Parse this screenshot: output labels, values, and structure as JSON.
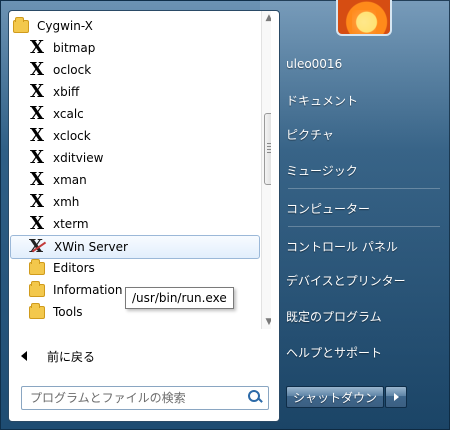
{
  "programs": {
    "folder_title": "Cygwin-X",
    "apps": [
      {
        "label": "bitmap",
        "icon": "x-icon"
      },
      {
        "label": "oclock",
        "icon": "x-icon"
      },
      {
        "label": "xbiff",
        "icon": "x-icon"
      },
      {
        "label": "xcalc",
        "icon": "x-icon"
      },
      {
        "label": "xclock",
        "icon": "x-icon"
      },
      {
        "label": "xditview",
        "icon": "x-icon"
      },
      {
        "label": "xman",
        "icon": "x-icon"
      },
      {
        "label": "xmh",
        "icon": "x-icon"
      },
      {
        "label": "xterm",
        "icon": "x-icon"
      },
      {
        "label": "XWin Server",
        "icon": "xwin-icon"
      }
    ],
    "folders": [
      "Editors",
      "Information",
      "Tools"
    ]
  },
  "tooltip": "/usr/bin/run.exe",
  "back": {
    "label": "前に戻る"
  },
  "search": {
    "placeholder": "プログラムとファイルの検索"
  },
  "right_menu": {
    "username": "uleo0016",
    "items": [
      "ドキュメント",
      "ピクチャ",
      "ミュージック",
      "コンピューター",
      "コントロール パネル",
      "デバイスとプリンター",
      "既定のプログラム",
      "ヘルプとサポート"
    ]
  },
  "shutdown": {
    "label": "シャットダウン"
  }
}
